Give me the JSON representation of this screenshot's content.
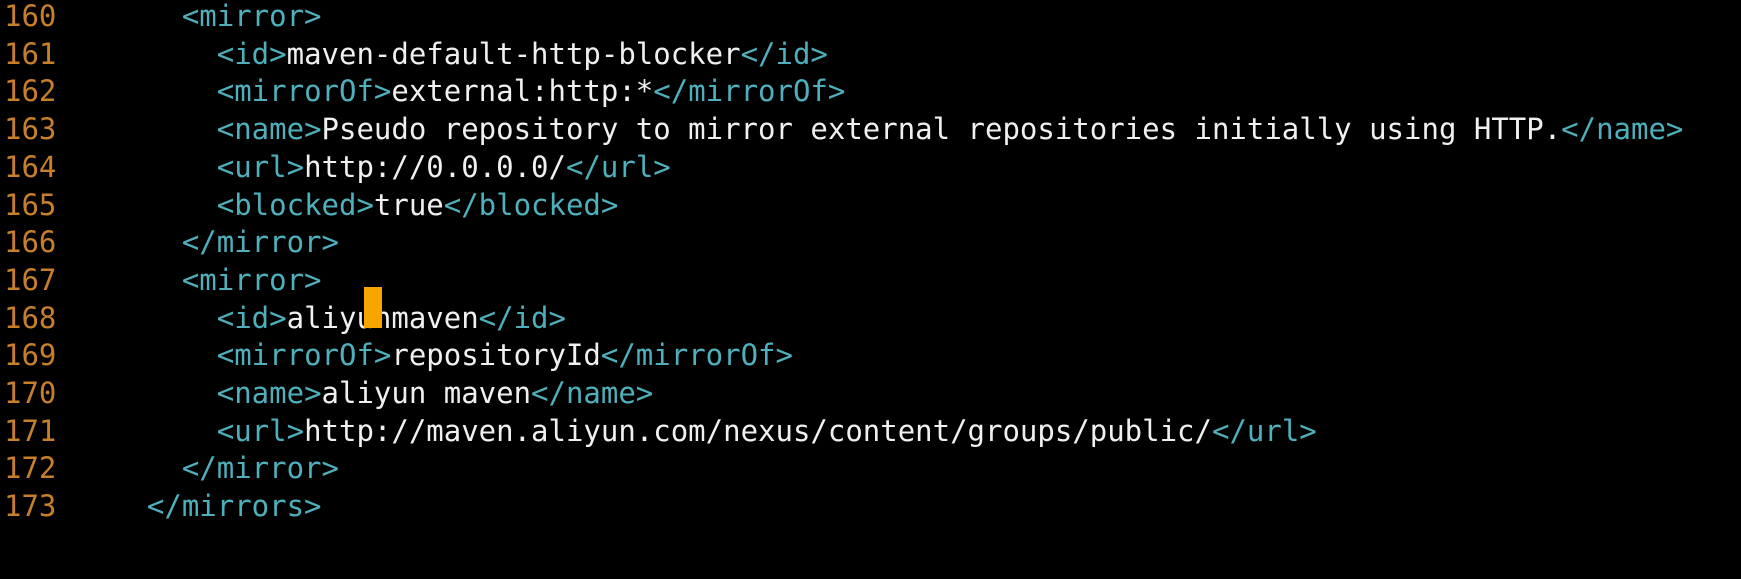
{
  "editor": {
    "cursor_color": "#f7a600",
    "line_number_color": "#c87f2a",
    "tag_color": "#4fb0bd",
    "text_color": "#f0f0f0",
    "background": "#000000",
    "lines": [
      {
        "number": "160",
        "indent": "    ",
        "open": "<mirror>",
        "text": "",
        "close": ""
      },
      {
        "number": "161",
        "indent": "      ",
        "open": "<id>",
        "text": "maven-default-http-blocker",
        "close": "</id>"
      },
      {
        "number": "162",
        "indent": "      ",
        "open": "<mirrorOf>",
        "text": "external:http:*",
        "close": "</mirrorOf>"
      },
      {
        "number": "163",
        "indent": "      ",
        "open": "<name>",
        "text": "Pseudo repository to mirror external repositories initially using HTTP.",
        "close": "</name>"
      },
      {
        "number": "164",
        "indent": "      ",
        "open": "<url>",
        "text": "http://0.0.0.0/",
        "close": "</url>"
      },
      {
        "number": "165",
        "indent": "      ",
        "open": "<blocked>",
        "text": "true",
        "close": "</blocked>"
      },
      {
        "number": "166",
        "indent": "    ",
        "open": "</mirror>",
        "text": "",
        "close": ""
      },
      {
        "number": "167",
        "indent": "    ",
        "open": "<mirror>",
        "text": "",
        "close": ""
      },
      {
        "number": "168",
        "indent": "      ",
        "open": "<id>",
        "text": "aliyunmaven",
        "close": "</id>"
      },
      {
        "number": "169",
        "indent": "      ",
        "open": "<mirrorOf>",
        "text": "repositoryId",
        "close": "</mirrorOf>"
      },
      {
        "number": "170",
        "indent": "      ",
        "open": "<name>",
        "text": "aliyun maven",
        "close": "</name>"
      },
      {
        "number": "171",
        "indent": "      ",
        "open": "<url>",
        "text": "http://maven.aliyun.com/nexus/content/groups/public/",
        "close": "</url>"
      },
      {
        "number": "172",
        "indent": "    ",
        "open": "</mirror>",
        "text": "",
        "close": ""
      },
      {
        "number": "173",
        "indent": "  ",
        "open": "</mirrors>",
        "text": "",
        "close": ""
      }
    ]
  }
}
